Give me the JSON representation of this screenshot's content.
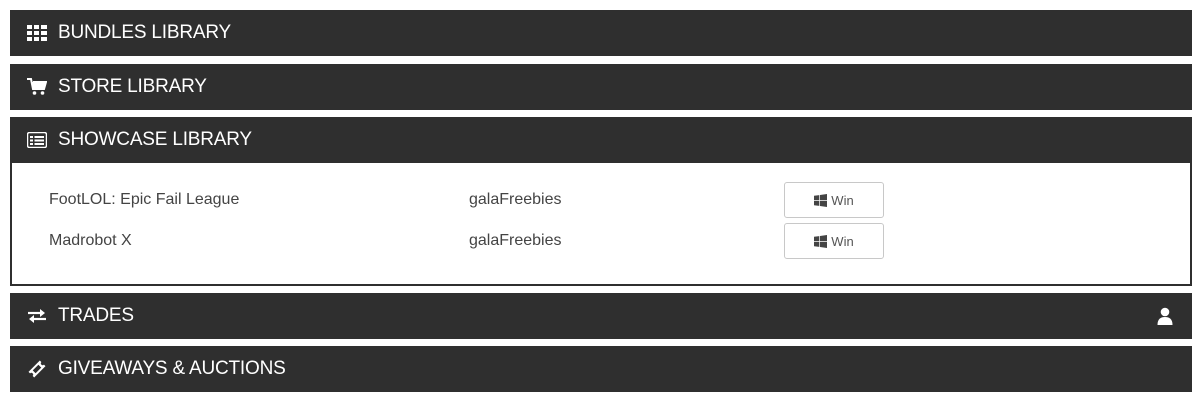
{
  "sections": {
    "bundles": {
      "label": "BUNDLES LIBRARY",
      "icon": "grid-icon"
    },
    "store": {
      "label": "STORE LIBRARY",
      "icon": "cart-icon"
    },
    "showcase": {
      "label": "SHOWCASE LIBRARY",
      "icon": "list-icon",
      "items": [
        {
          "title": "FootLOL: Epic Fail League",
          "source": "galaFreebies",
          "platform": "Win",
          "platform_icon": "windows-icon"
        },
        {
          "title": "Madrobot X",
          "source": "galaFreebies",
          "platform": "Win",
          "platform_icon": "windows-icon"
        }
      ]
    },
    "trades": {
      "label": "TRADES",
      "icon": "exchange-icon",
      "right_icon": "user-icon"
    },
    "giveaways": {
      "label": "GIVEAWAYS & AUCTIONS",
      "icon": "ticket-icon"
    }
  },
  "colors": {
    "header_bg": "#2f2f2f",
    "header_text": "#ffffff",
    "body_text": "#444444"
  }
}
